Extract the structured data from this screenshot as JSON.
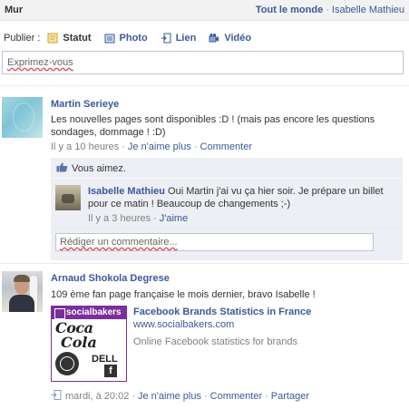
{
  "header": {
    "title": "Mur",
    "filter_all": "Tout le monde",
    "separator": "·",
    "filter_user": "Isabelle Mathieu"
  },
  "publisher": {
    "label": "Publier :",
    "items": [
      {
        "label": "Statut",
        "icon": "status-icon"
      },
      {
        "label": "Photo",
        "icon": "photo-icon"
      },
      {
        "label": "Lien",
        "icon": "link-icon"
      },
      {
        "label": "Vidéo",
        "icon": "video-icon"
      }
    ],
    "placeholder": "Exprimez-vous"
  },
  "posts": [
    {
      "author": "Martin Serieye",
      "message": "Les nouvelles pages sont disponibles :D ! (mais pas encore les questions sondages, dommage ! :D)",
      "time": "Il y a 10 heures",
      "unlike": "Je n'aime plus",
      "comment": "Commenter",
      "like_summary": "Vous aimez.",
      "comments": [
        {
          "author": "Isabelle Mathieu",
          "text": "Oui Martin j'ai vu ça hier soir. Je prépare un billet pour ce matin ! Beaucoup de changements ;-)",
          "time": "Il y a 3 heures",
          "like": "J'aime"
        }
      ],
      "comment_placeholder": "Rédiger un commentaire..."
    },
    {
      "author": "Arnaud Shokola Degrese",
      "message": "109 ème fan page française le mois dernier, bravo Isabelle !",
      "attachment": {
        "title": "Facebook Brands Statistics in France",
        "url": "www.socialbakers.com",
        "description": "Online Facebook statistics for brands",
        "logo_text": "socialbakers",
        "brands": [
          "Coca",
          "Cola",
          "DELL",
          "f"
        ]
      },
      "time": "mardi, à 20:02",
      "unlike": "Je n'aime plus",
      "comment": "Commenter",
      "share": "Partager"
    }
  ],
  "colors": {
    "link": "#3b5998",
    "meta": "#808080",
    "comment_bg": "#edeff4",
    "socialbakers": "#7b2f9b"
  }
}
